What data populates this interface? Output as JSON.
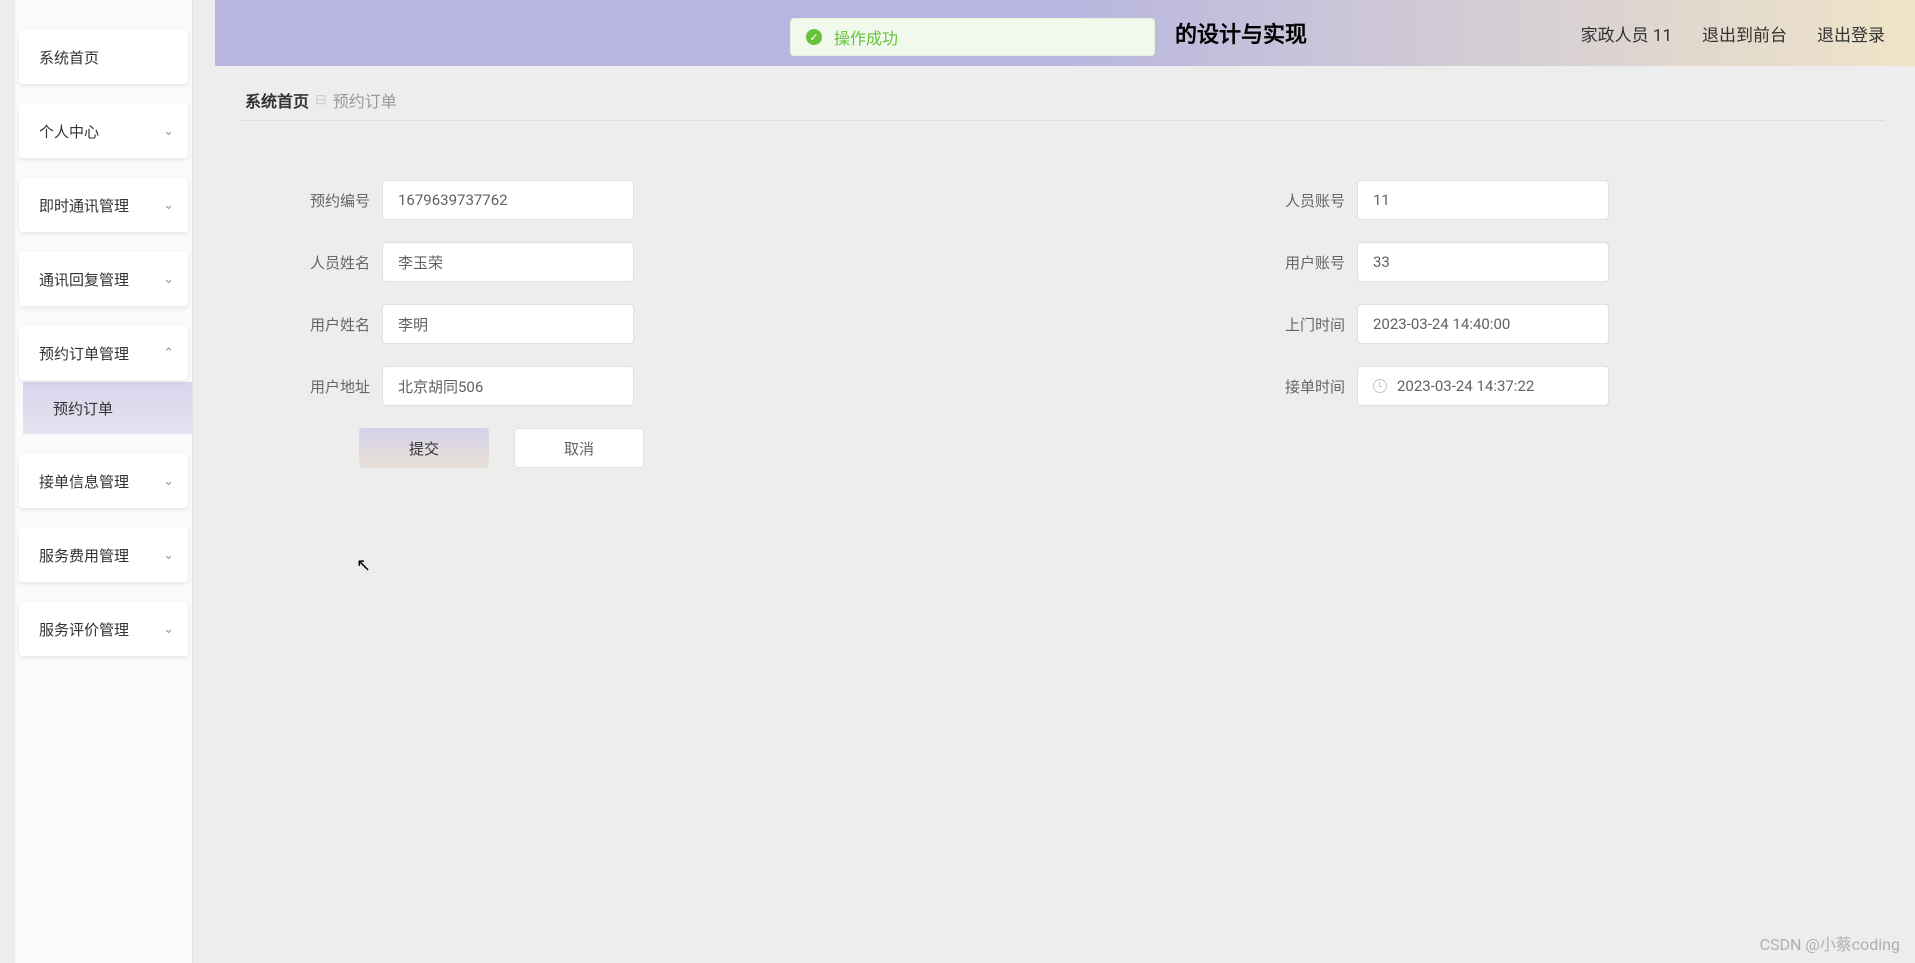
{
  "header": {
    "title": "的设计与实现",
    "user_label": "家政人员 11",
    "logout_frontend": "退出到前台",
    "logout": "退出登录"
  },
  "toast": {
    "message": "操作成功"
  },
  "sidebar": {
    "items": [
      {
        "label": "系统首页",
        "expandable": false
      },
      {
        "label": "个人中心",
        "expandable": true
      },
      {
        "label": "即时通讯管理",
        "expandable": true
      },
      {
        "label": "通讯回复管理",
        "expandable": true
      },
      {
        "label": "预约订单管理",
        "expandable": true,
        "expanded": true,
        "children": [
          {
            "label": "预约订单"
          }
        ]
      },
      {
        "label": "接单信息管理",
        "expandable": true
      },
      {
        "label": "服务费用管理",
        "expandable": true
      },
      {
        "label": "服务评价管理",
        "expandable": true
      }
    ]
  },
  "breadcrumb": {
    "home": "系统首页",
    "current": "预约订单"
  },
  "form": {
    "fields": {
      "reservation_no": {
        "label": "预约编号",
        "value": "1679639737762"
      },
      "staff_account": {
        "label": "人员账号",
        "value": "11"
      },
      "staff_name": {
        "label": "人员姓名",
        "value": "李玉荣"
      },
      "user_account": {
        "label": "用户账号",
        "value": "33"
      },
      "user_name": {
        "label": "用户姓名",
        "value": "李明"
      },
      "visit_time": {
        "label": "上门时间",
        "value": "2023-03-24 14:40:00"
      },
      "user_address": {
        "label": "用户地址",
        "value": "北京胡同506"
      },
      "accept_time": {
        "label": "接单时间",
        "value": "2023-03-24 14:37:22"
      }
    },
    "buttons": {
      "submit": "提交",
      "cancel": "取消"
    }
  },
  "watermark": "CSDN @小蔡coding"
}
